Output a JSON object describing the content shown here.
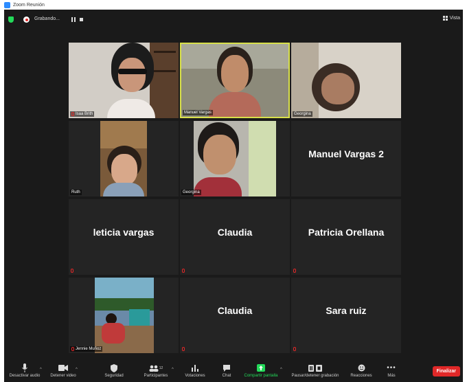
{
  "window": {
    "title": "Zoom Reunión"
  },
  "topbar": {
    "recording_label": "Grabando...",
    "view_label": "Vista"
  },
  "tiles": {
    "t1": {
      "label": "Isaa Brith"
    },
    "t2": {
      "label": "Manuel Vargas"
    },
    "t3": {
      "label": "Georgina"
    },
    "t4": {
      "label": "Ruth"
    },
    "t5": {
      "label": "Georgina"
    },
    "t6": {
      "name": "Manuel Vargas 2"
    },
    "t7": {
      "name": "leticia vargas"
    },
    "t8": {
      "name": "Claudia"
    },
    "t9": {
      "name": "Patricia Orellana"
    },
    "t10": {
      "label": "Jennie Muñoz"
    },
    "t11": {
      "name": "Claudia"
    },
    "t12": {
      "name": "Sara ruiz"
    }
  },
  "toolbar": {
    "mute": "Desactivar audio",
    "video": "Detener video",
    "security": "Seguridad",
    "participants": "Participantes",
    "participants_count": "12",
    "polls": "Votaciones",
    "chat": "Chat",
    "share": "Compartir pantalla",
    "record": "Pausar/detener grabación",
    "reactions": "Reacciones",
    "more": "Más",
    "end": "Finalizar"
  },
  "colors": {
    "active_speaker": "#d8e04a",
    "share_green": "#23d959",
    "end_red": "#e02828",
    "bg": "#1a1a1a",
    "tile": "#242424"
  }
}
